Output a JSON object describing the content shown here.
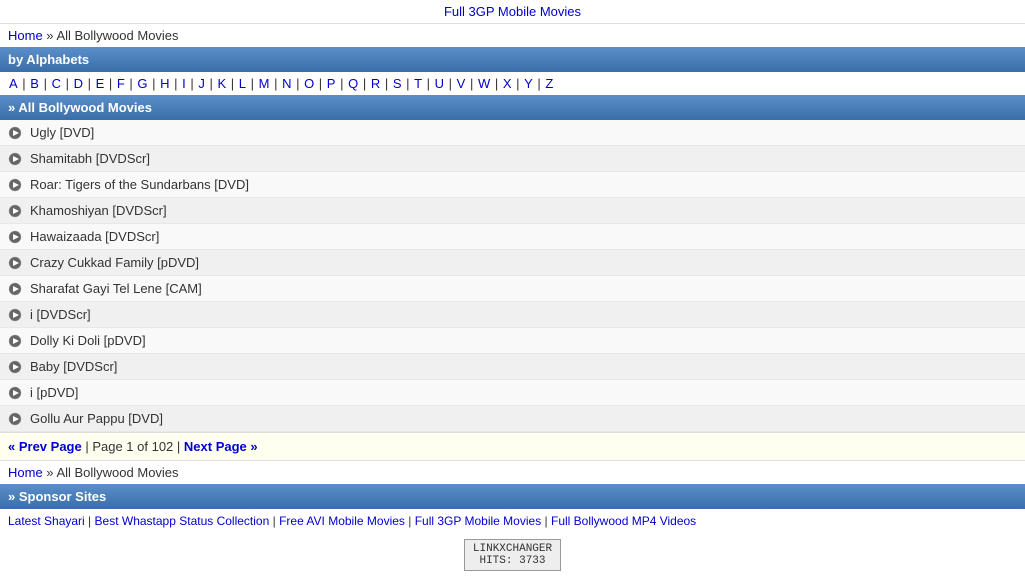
{
  "topbar": {
    "text": "Full 3GP Mobile Movies"
  },
  "breadcrumb": {
    "home": "Home",
    "separator": " » ",
    "current": "All Bollywood Movies"
  },
  "alphabets_header": {
    "label": "by Alphabets"
  },
  "alphabets": [
    "A",
    "B",
    "C",
    "D",
    "E",
    "F",
    "G",
    "H",
    "I",
    "J",
    "K",
    "L",
    "M",
    "N",
    "O",
    "P",
    "Q",
    "R",
    "S",
    "T",
    "U",
    "V",
    "W",
    "X",
    "Y",
    "Z"
  ],
  "list_header": {
    "label": "» All Bollywood Movies"
  },
  "movies": [
    {
      "title": "Ugly [DVD]"
    },
    {
      "title": "Shamitabh [DVDScr]"
    },
    {
      "title": "Roar: Tigers of the Sundarbans [DVD]"
    },
    {
      "title": "Khamoshiyan [DVDScr]"
    },
    {
      "title": "Hawaizaada [DVDScr]"
    },
    {
      "title": "Crazy Cukkad Family [pDVD]"
    },
    {
      "title": "Sharafat Gayi Tel Lene [CAM]"
    },
    {
      "title": "i [DVDScr]"
    },
    {
      "title": "Dolly Ki Doli [pDVD]"
    },
    {
      "title": "Baby [DVDScr]"
    },
    {
      "title": "i [pDVD]"
    },
    {
      "title": "Gollu Aur Pappu [DVD]"
    }
  ],
  "pagination": {
    "prev": "« Prev Page",
    "sep1": " | ",
    "page_info": "Page 1 of 102",
    "sep2": " | ",
    "next": "Next Page »"
  },
  "breadcrumb2": {
    "home": "Home",
    "separator": " » ",
    "current": "All Bollywood Movies"
  },
  "sponsor_header": {
    "label": "» Sponsor Sites"
  },
  "sponsor_links": [
    {
      "label": "Latest Shayari"
    },
    {
      "label": "Best Whastapp Status Collection"
    },
    {
      "label": "Free AVI Mobile Movies"
    },
    {
      "label": "Full 3GP Mobile Movies"
    },
    {
      "label": "Full Bollywood MP4 Videos"
    }
  ],
  "footer": {
    "badge_line1": "LINKXCHANGER",
    "badge_line2": "HITS: 3733"
  }
}
